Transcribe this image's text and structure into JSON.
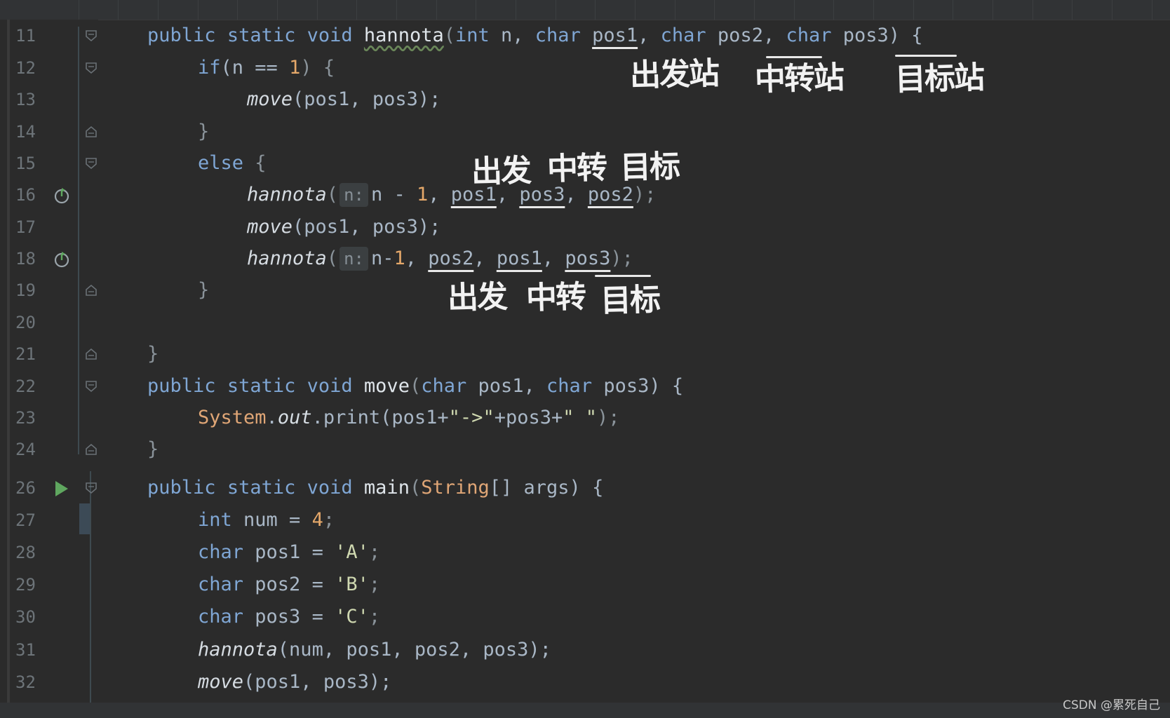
{
  "lines": [
    {
      "no": "11",
      "t": [
        "public",
        " ",
        "static",
        " ",
        "void",
        " ",
        "hannota",
        "(",
        "int",
        " n, ",
        "char",
        " ",
        "pos1",
        ", ",
        "char",
        " pos2, ",
        "char",
        " pos3) {"
      ]
    },
    {
      "no": "12",
      "t": [
        "if",
        "(n == ",
        "1",
        ") {"
      ]
    },
    {
      "no": "13",
      "t": [
        "move",
        "(pos1, pos3);"
      ]
    },
    {
      "no": "14",
      "t": [
        "}"
      ]
    },
    {
      "no": "15",
      "t": [
        "else",
        " {"
      ]
    },
    {
      "no": "16",
      "t": [
        "hannota",
        "(",
        "n:",
        "n - ",
        "1",
        ", ",
        "pos1",
        ", ",
        "pos3",
        ", ",
        "pos2",
        ");"
      ]
    },
    {
      "no": "17",
      "t": [
        "move",
        "(pos1, pos3);"
      ]
    },
    {
      "no": "18",
      "t": [
        "hannota",
        "(",
        "n:",
        "n-",
        "1",
        ", ",
        "pos2",
        ", ",
        "pos1",
        ", ",
        "pos3",
        ");"
      ]
    },
    {
      "no": "19",
      "t": [
        "}"
      ]
    },
    {
      "no": "20",
      "t": []
    },
    {
      "no": "21",
      "t": [
        "}"
      ]
    },
    {
      "no": "22",
      "t": [
        "public",
        " ",
        "static",
        " ",
        "void",
        " ",
        "move",
        "(",
        "char",
        " pos1, ",
        "char",
        " pos3) {"
      ]
    },
    {
      "no": "23",
      "t": [
        "System",
        ".",
        "out",
        ".print(pos1+",
        "\"->\"",
        "+pos3+",
        "\" \"",
        ");"
      ]
    },
    {
      "no": "24",
      "t": [
        "}"
      ]
    },
    {
      "no": "26",
      "t": [
        "public",
        " ",
        "static",
        " ",
        "void",
        " ",
        "main",
        "(",
        "String",
        "[] args) {"
      ]
    },
    {
      "no": "27",
      "t": [
        "int",
        " num = ",
        "4",
        ";"
      ]
    },
    {
      "no": "28",
      "t": [
        "char",
        " pos1 = ",
        "'A'",
        ";"
      ]
    },
    {
      "no": "29",
      "t": [
        "char",
        " pos2 = ",
        "'B'",
        ";"
      ]
    },
    {
      "no": "30",
      "t": [
        "char",
        " pos3 = ",
        "'C'",
        ";"
      ]
    },
    {
      "no": "31",
      "t": [
        "hannota",
        "(num, pos1, pos2, pos3);"
      ]
    },
    {
      "no": "32",
      "t": [
        "move",
        "(pos1, pos3);"
      ]
    }
  ],
  "annotations": {
    "a1": "出发站",
    "a2": "中转站",
    "a3": "目标站",
    "b1": "出发",
    "b2": "中转",
    "b3": "目标",
    "c1": "出发",
    "c2": "中转",
    "c3": "目标"
  },
  "watermark": "CSDN @累死自己",
  "colors": {
    "background": "#2b2b2b",
    "keyword": "#7fa6d4",
    "number": "#e5a86a",
    "run_icon": "#5fa75f"
  },
  "icons": {
    "fold": "fold-arrow-icon",
    "recursion": "recursive-call-icon",
    "run": "run-arrow-icon"
  }
}
